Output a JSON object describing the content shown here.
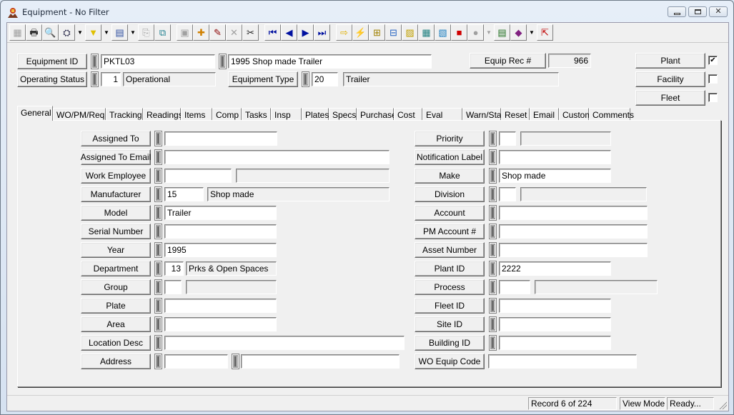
{
  "window": {
    "title": "Equipment - No Filter",
    "controls": [
      "minimize",
      "maximize",
      "close"
    ]
  },
  "toolbar": {
    "buttons": [
      {
        "name": "form-view",
        "glyph": "▦",
        "disabled": true
      },
      {
        "name": "print",
        "glyph": "🖶"
      },
      {
        "name": "print-preview",
        "glyph": "🔍"
      },
      {
        "name": "find",
        "glyph": "⛭",
        "dropdown": true
      },
      {
        "name": "filter",
        "glyph": "▼",
        "dropdown": true
      },
      {
        "name": "report",
        "glyph": "▤",
        "dropdown": true
      },
      {
        "name": "properties",
        "glyph": "⎘",
        "disabled": true
      },
      {
        "name": "copy-record",
        "glyph": "⧉"
      },
      {
        "name": "save",
        "glyph": "▣",
        "disabled": true
      },
      {
        "name": "new-record",
        "glyph": "✚"
      },
      {
        "name": "edit",
        "glyph": "✎"
      },
      {
        "name": "delete",
        "glyph": "✕",
        "disabled": true
      },
      {
        "name": "cut",
        "glyph": "✂"
      },
      {
        "name": "first-record",
        "glyph": "⏮"
      },
      {
        "name": "previous-record",
        "glyph": "◀"
      },
      {
        "name": "next-record",
        "glyph": "▶"
      },
      {
        "name": "last-record",
        "glyph": "⏭"
      },
      {
        "name": "go-to",
        "glyph": "⇨"
      },
      {
        "name": "quick-action",
        "glyph": "⚡"
      },
      {
        "name": "hierarchy",
        "glyph": "⊞"
      },
      {
        "name": "relationships",
        "glyph": "⊟"
      },
      {
        "name": "equipment-image",
        "glyph": "▨"
      },
      {
        "name": "calculator",
        "glyph": "▦"
      },
      {
        "name": "map",
        "glyph": "▧"
      },
      {
        "name": "toolbox",
        "glyph": "■"
      },
      {
        "name": "search-globe",
        "glyph": "●",
        "disabled": true,
        "dropdown": true
      },
      {
        "name": "spreadsheet",
        "glyph": "▤"
      },
      {
        "name": "manual",
        "glyph": "◆",
        "dropdown": true
      },
      {
        "name": "exit",
        "glyph": "⇱"
      }
    ]
  },
  "header": {
    "equipment_id_label": "Equipment ID",
    "equipment_id": "PKTL03",
    "equipment_description": "1995 Shop made Trailer",
    "operating_status_label": "Operating Status",
    "operating_status_code": "1",
    "operating_status": "Operational",
    "equipment_type_label": "Equipment Type",
    "equipment_type_code": "20",
    "equipment_type": "Trailer",
    "equip_rec_label": "Equip Rec #",
    "equip_rec": "966",
    "plant_label": "Plant",
    "plant_checked": true,
    "facility_label": "Facility",
    "facility_checked": false,
    "fleet_label": "Fleet",
    "fleet_checked": false
  },
  "tabs": [
    {
      "label": "General",
      "active": true
    },
    {
      "label": "WO/PM/Req"
    },
    {
      "label": "Tracking"
    },
    {
      "label": "Readings"
    },
    {
      "label": "Items"
    },
    {
      "label": "Comp"
    },
    {
      "label": "Tasks"
    },
    {
      "label": "Insp"
    },
    {
      "label": "Plates"
    },
    {
      "label": "Specs"
    },
    {
      "label": "Purchase"
    },
    {
      "label": "Cost"
    },
    {
      "label": "Eval"
    },
    {
      "label": "Warn/Start"
    },
    {
      "label": "Reset"
    },
    {
      "label": "Email"
    },
    {
      "label": "Custom"
    },
    {
      "label": "Comments"
    }
  ],
  "general": {
    "left": {
      "assigned_to": {
        "label": "Assigned To",
        "value": ""
      },
      "assigned_to_email": {
        "label": "Assigned To Email",
        "value": ""
      },
      "work_employee": {
        "label": "Work Employee",
        "value": "",
        "desc": ""
      },
      "manufacturer": {
        "label": "Manufacturer",
        "value": "15",
        "desc": "Shop made"
      },
      "model": {
        "label": "Model",
        "value": "Trailer"
      },
      "serial_number": {
        "label": "Serial Number",
        "value": ""
      },
      "year": {
        "label": "Year",
        "value": "1995"
      },
      "department": {
        "label": "Department",
        "value": "13",
        "desc": "Prks & Open Spaces"
      },
      "group": {
        "label": "Group",
        "value": "",
        "desc": ""
      },
      "plate": {
        "label": "Plate",
        "value": ""
      },
      "area": {
        "label": "Area",
        "value": ""
      },
      "location_desc": {
        "label": "Location Desc",
        "value": ""
      },
      "address": {
        "label": "Address",
        "value": "",
        "value2": ""
      }
    },
    "right": {
      "priority": {
        "label": "Priority",
        "value": "",
        "desc": ""
      },
      "notification_label": {
        "label": "Notification Label",
        "value": ""
      },
      "make": {
        "label": "Make",
        "value": "Shop made"
      },
      "division": {
        "label": "Division",
        "value": "",
        "desc": ""
      },
      "account": {
        "label": "Account",
        "value": ""
      },
      "pm_account": {
        "label": "PM Account #",
        "value": ""
      },
      "asset_number": {
        "label": "Asset Number",
        "value": ""
      },
      "plant_id": {
        "label": "Plant ID",
        "value": "2222"
      },
      "process": {
        "label": "Process",
        "value": "",
        "desc": ""
      },
      "fleet_id": {
        "label": "Fleet ID",
        "value": ""
      },
      "site_id": {
        "label": "Site ID",
        "value": ""
      },
      "building_id": {
        "label": "Building ID",
        "value": ""
      },
      "wo_equip_code": {
        "label": "WO Equip Code",
        "value": ""
      }
    }
  },
  "status_bar": {
    "record": "Record 6 of 224",
    "mode": "View Mode",
    "state": "Ready..."
  }
}
